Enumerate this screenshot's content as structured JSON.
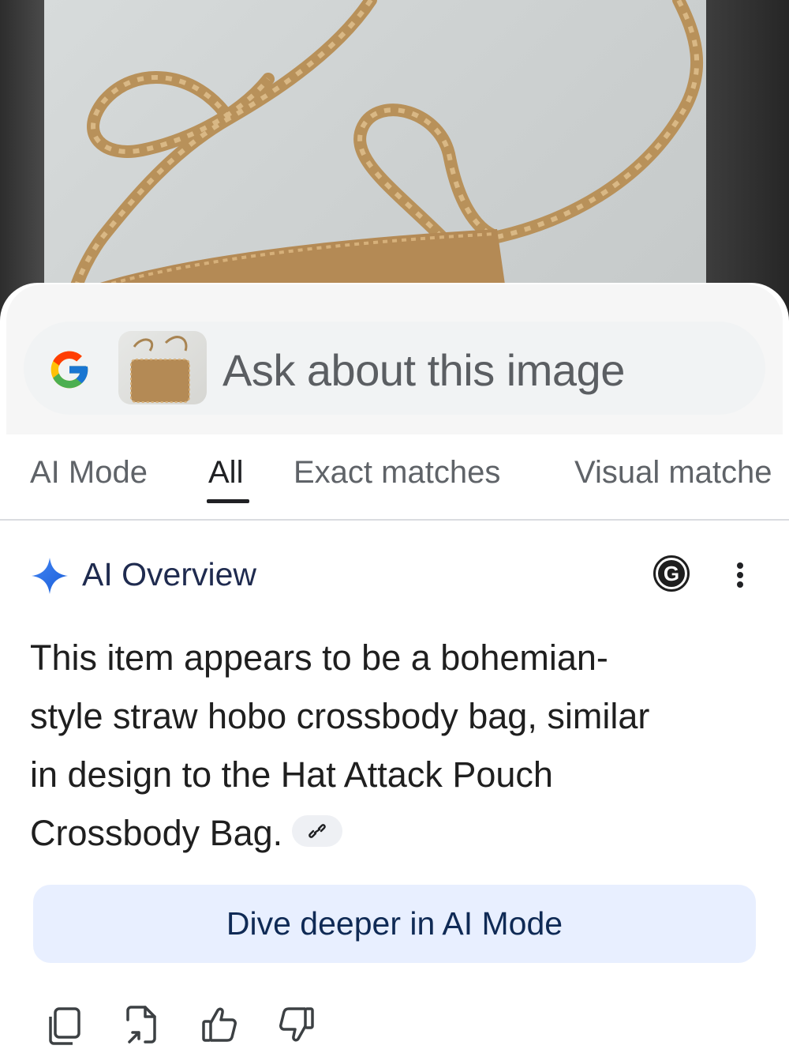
{
  "search": {
    "placeholder": "Ask about this image"
  },
  "tabs": [
    {
      "label": "AI Mode",
      "active": false
    },
    {
      "label": "All",
      "active": true
    },
    {
      "label": "Exact matches",
      "active": false
    },
    {
      "label": "Visual matche",
      "active": false
    }
  ],
  "overview": {
    "title": "AI Overview",
    "badge_letter": "G",
    "text": "This item appears to be a bohemian-style straw hobo crossbody bag, similar in design to the Hat Attack Pouch Crossbody Bag.",
    "lines": [
      "This item appears to be a bohemian-",
      "style straw hobo crossbody bag, similar",
      "in design to the Hat Attack Pouch",
      "Crossbody Bag."
    ]
  },
  "dive_button": {
    "label": "Dive deeper in AI Mode"
  },
  "actions": [
    {
      "icon": "copy-icon"
    },
    {
      "icon": "share-icon"
    },
    {
      "icon": "thumbs-up-icon"
    },
    {
      "icon": "thumbs-down-icon"
    }
  ],
  "colors": {
    "accent_blue": "#1a73e8",
    "dive_bg": "#e8efff",
    "search_bg": "#f1f3f4"
  }
}
